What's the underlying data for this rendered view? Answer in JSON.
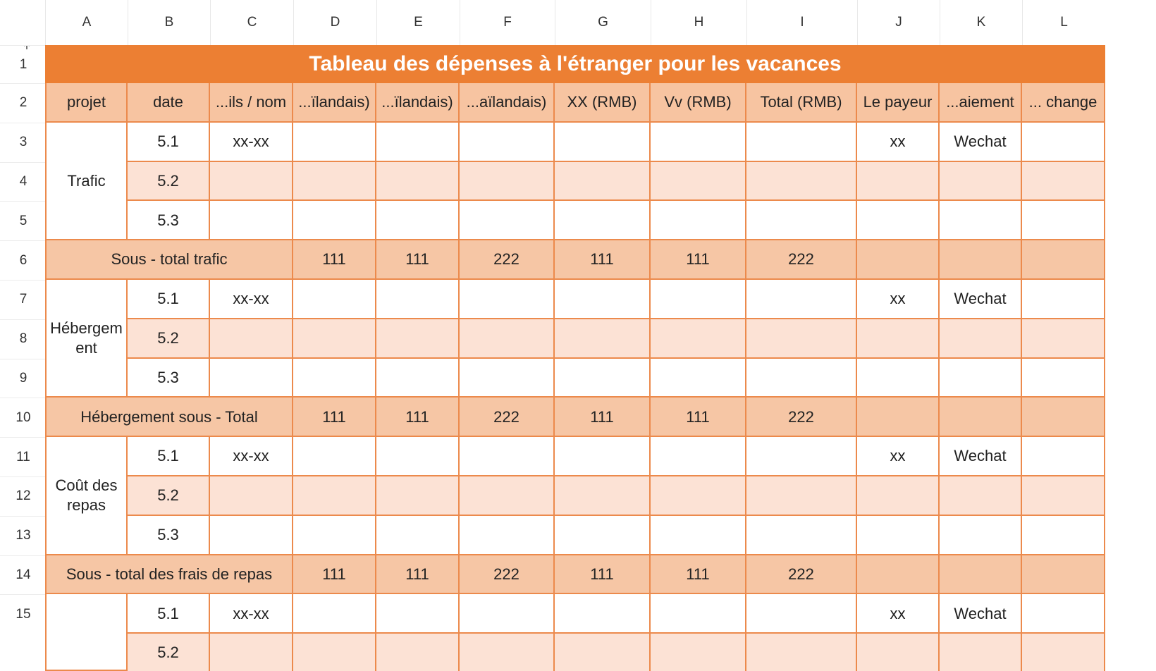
{
  "columns": [
    "A",
    "B",
    "C",
    "D",
    "E",
    "F",
    "G",
    "H",
    "I",
    "J",
    "K",
    "L"
  ],
  "rows": [
    "1",
    "2",
    "3",
    "4",
    "5",
    "6",
    "7",
    "8",
    "9",
    "10",
    "11",
    "12",
    "13",
    "14",
    "15"
  ],
  "title": "Tableau des dépenses à l'étranger pour les vacances",
  "header": [
    "projet",
    "date",
    "...ils / nom",
    "...ïlandais)",
    "...ïlandais)",
    "...aïlandais)",
    "XX (RMB)",
    "Vv (RMB)",
    "Total (RMB)",
    "Le payeur",
    "...aiement",
    "... change"
  ],
  "groups": [
    {
      "label": "Trafic",
      "subtotal_label": "Sous - total trafic"
    },
    {
      "label": "Hébergem ent",
      "subtotal_label": "Hébergement sous - Total"
    },
    {
      "label": "Coût des repas",
      "subtotal_label": "Sous - total des frais de repas"
    },
    {
      "label": "",
      "subtotal_label": ""
    }
  ],
  "detail": {
    "dates": [
      "5.1",
      "5.2",
      "5.3"
    ],
    "name_first": "xx-xx",
    "payer_first": "xx",
    "payment_first": "Wechat"
  },
  "subtotals": [
    "111",
    "111",
    "222",
    "111",
    "111",
    "222"
  ],
  "colors": {
    "title": "#ec7f33",
    "header": "#f7c4a1",
    "subtotal": "#f6c6a5",
    "band": "#fce2d5",
    "border": "#ec8a4c"
  }
}
